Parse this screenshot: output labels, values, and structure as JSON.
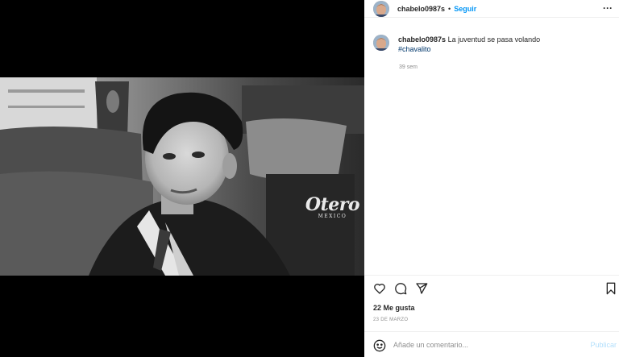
{
  "post": {
    "username": "chabelo0987s",
    "separator": "•",
    "follow_label": "Seguir",
    "more_label": "···",
    "caption_text": "La juventud se pasa volando",
    "hashtag": "#chavalito",
    "caption_age": "39 sem",
    "likes_label": "22 Me gusta",
    "date_label": "23 DE MARZO"
  },
  "photo": {
    "watermark_brand": "Otero",
    "watermark_city": "MEXICO"
  },
  "comment": {
    "placeholder": "Añade un comentario...",
    "publish_label": "Publicar"
  },
  "icons": {
    "like": "heart-icon",
    "comment": "comment-bubble-icon",
    "share": "send-icon",
    "save": "bookmark-icon",
    "emoji": "smiley-icon",
    "more": "more-options-icon"
  },
  "colors": {
    "link_blue": "#0095f6",
    "publish_disabled": "#b2dffc",
    "hashtag": "#00376b",
    "muted": "#8e8e8e"
  }
}
